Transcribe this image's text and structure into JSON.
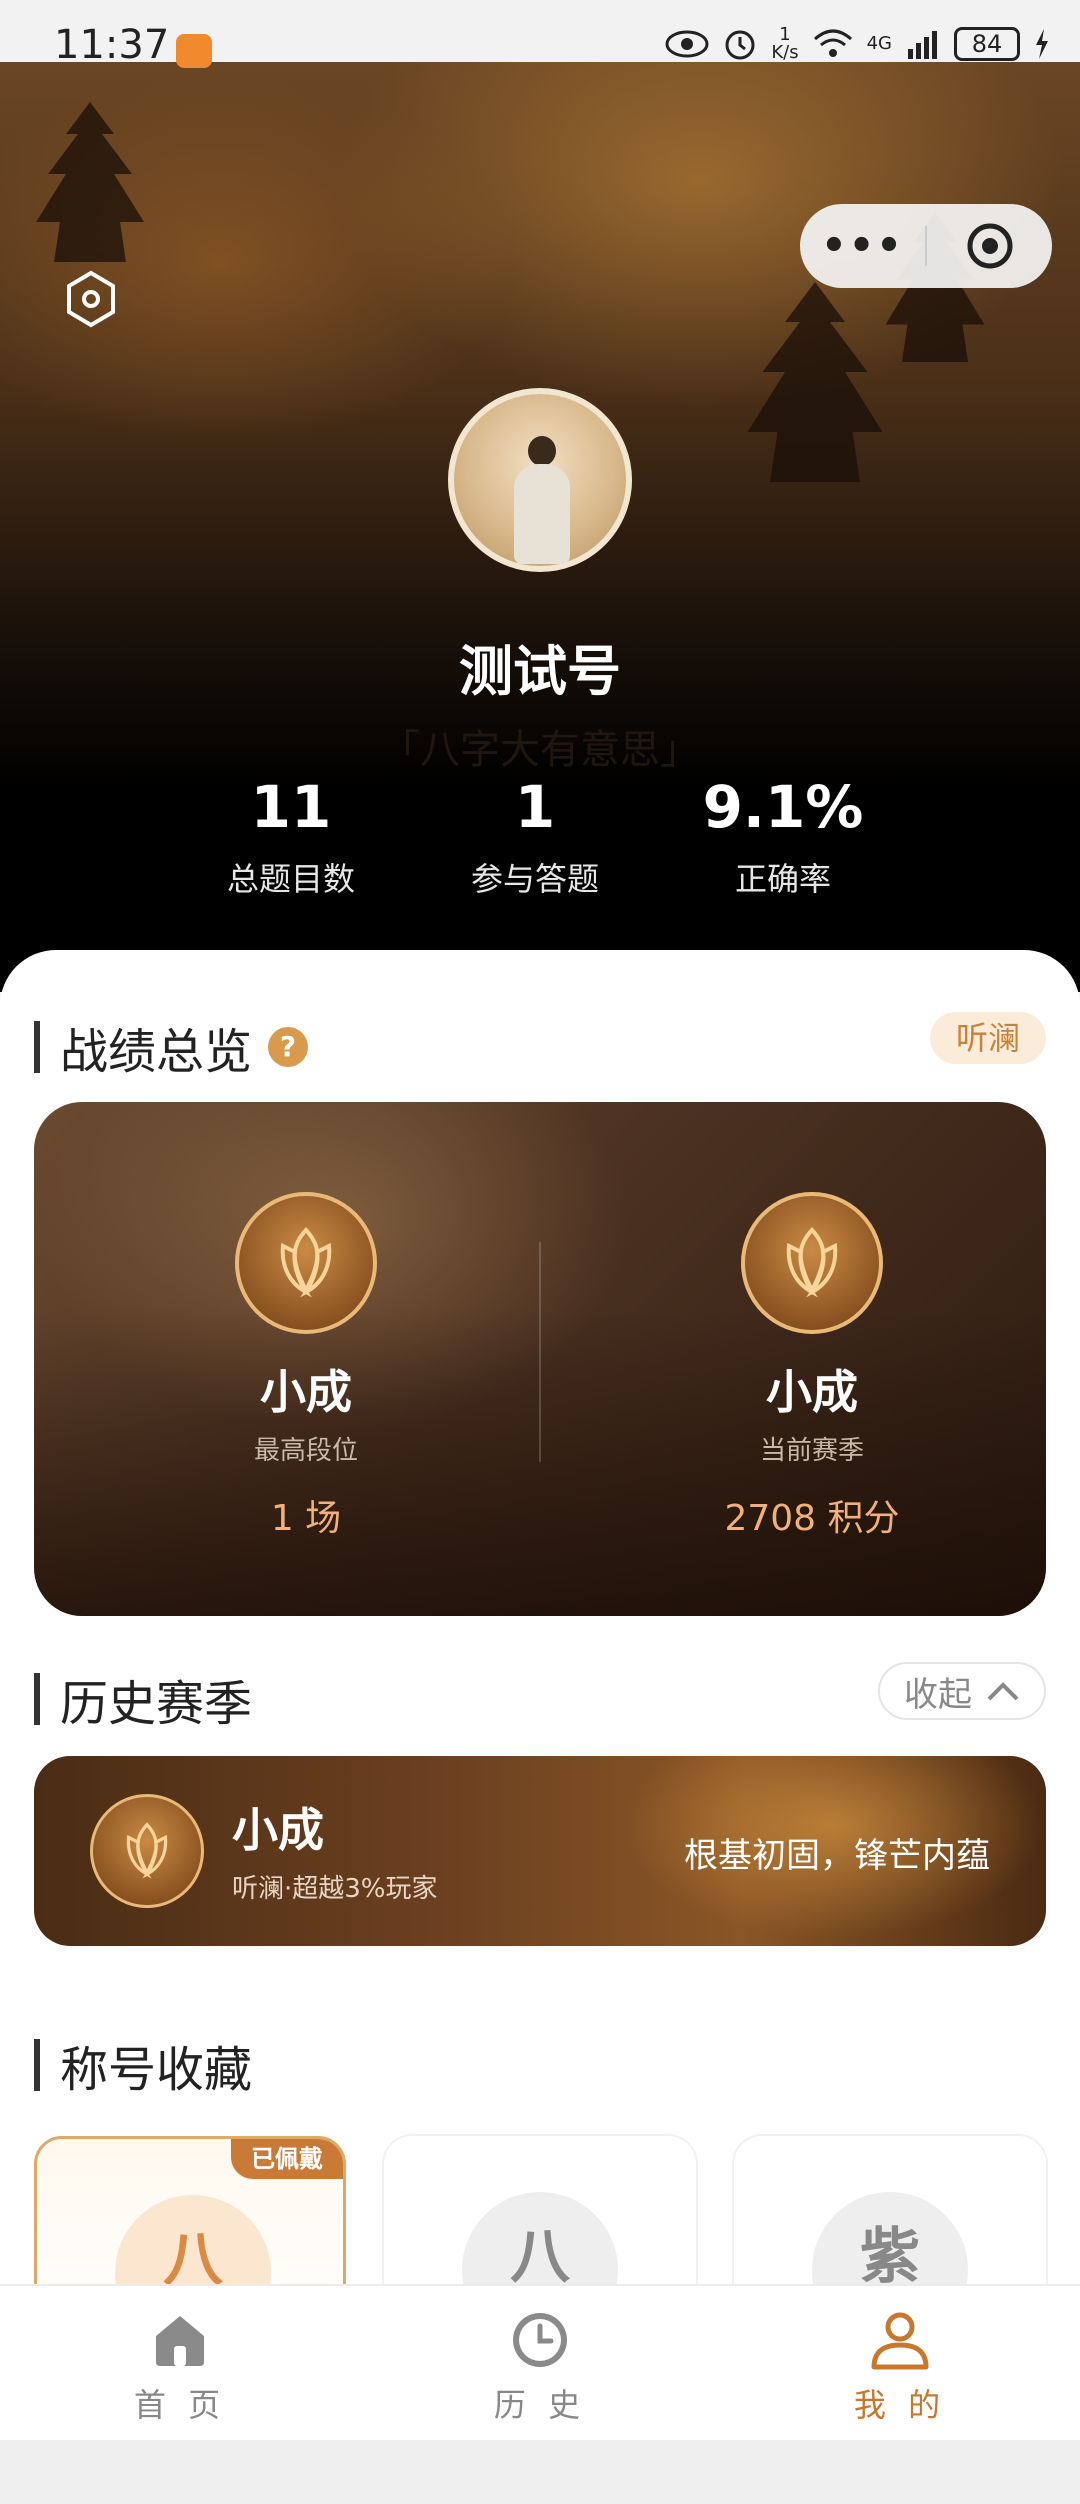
{
  "status_bar": {
    "time": "11:37",
    "speed_top": "1",
    "speed_unit": "K/s",
    "network": "4G",
    "battery": "84"
  },
  "profile": {
    "username": "测试号",
    "signature": "「八字大有意思」",
    "stats": [
      {
        "value": "11",
        "label": "总题目数"
      },
      {
        "value": "1",
        "label": "参与答题"
      },
      {
        "value": "9.1%",
        "label": "正确率"
      }
    ]
  },
  "overview": {
    "title": "战绩总览",
    "help": "?",
    "tag": "听澜",
    "best": {
      "rank": "小成",
      "sub": "最高段位",
      "value": "1 场"
    },
    "current": {
      "rank": "小成",
      "sub": "当前赛季",
      "value": "2708 积分"
    }
  },
  "history": {
    "title": "历史赛季",
    "collapse_label": "收起",
    "season": {
      "rank": "小成",
      "sub": "听澜·超越3%玩家",
      "motto": "根基初固，锋芒内蕴"
    }
  },
  "titles": {
    "title": "称号收藏",
    "items": [
      {
        "char": "八",
        "badge": "已佩戴",
        "active": true
      },
      {
        "char": "八",
        "active": false
      },
      {
        "char": "紫",
        "active": false
      }
    ]
  },
  "tabbar": {
    "items": [
      {
        "label": "首 页",
        "icon": "home-icon"
      },
      {
        "label": "历 史",
        "icon": "clock-icon"
      },
      {
        "label": "我 的",
        "icon": "user-icon",
        "active": true
      }
    ]
  },
  "colors": {
    "accent": "#c8782c",
    "tag_bg": "#fbecd9",
    "gold": "#e9b978"
  }
}
